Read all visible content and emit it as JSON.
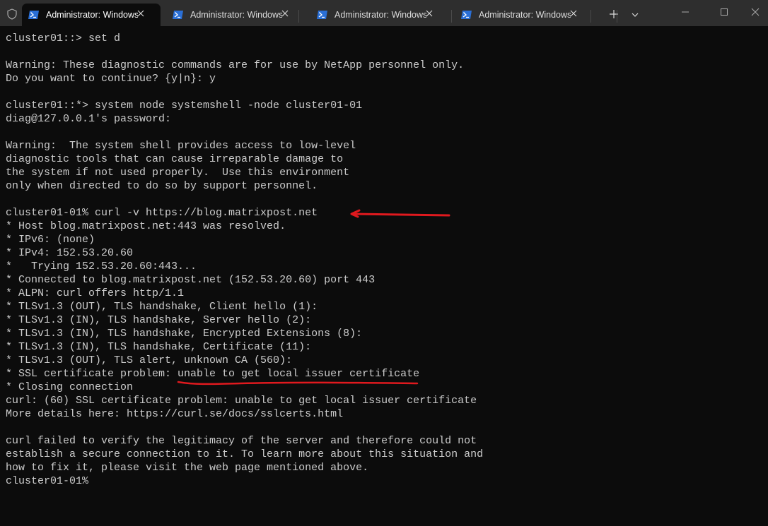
{
  "window": {
    "tabs": [
      {
        "label": "Administrator: Windows PowerShell",
        "active": true
      },
      {
        "label": "Administrator: Windows PowerShell",
        "active": false
      },
      {
        "label": "Administrator: Windows PowerShell",
        "active": false
      },
      {
        "label": "Administrator: Windows PowerShell",
        "active": false
      }
    ],
    "accent": "#2a6fd6"
  },
  "terminal": {
    "lines": [
      "cluster01::> set d",
      "",
      "Warning: These diagnostic commands are for use by NetApp personnel only.",
      "Do you want to continue? {y|n}: y",
      "",
      "cluster01::*> system node systemshell -node cluster01-01",
      "diag@127.0.0.1's password:",
      "",
      "Warning:  The system shell provides access to low-level",
      "diagnostic tools that can cause irreparable damage to",
      "the system if not used properly.  Use this environment",
      "only when directed to do so by support personnel.",
      "",
      "cluster01-01% curl -v https://blog.matrixpost.net",
      "* Host blog.matrixpost.net:443 was resolved.",
      "* IPv6: (none)",
      "* IPv4: 152.53.20.60",
      "*   Trying 152.53.20.60:443...",
      "* Connected to blog.matrixpost.net (152.53.20.60) port 443",
      "* ALPN: curl offers http/1.1",
      "* TLSv1.3 (OUT), TLS handshake, Client hello (1):",
      "* TLSv1.3 (IN), TLS handshake, Server hello (2):",
      "* TLSv1.3 (IN), TLS handshake, Encrypted Extensions (8):",
      "* TLSv1.3 (IN), TLS handshake, Certificate (11):",
      "* TLSv1.3 (OUT), TLS alert, unknown CA (560):",
      "* SSL certificate problem: unable to get local issuer certificate",
      "* Closing connection",
      "curl: (60) SSL certificate problem: unable to get local issuer certificate",
      "More details here: https://curl.se/docs/sslcerts.html",
      "",
      "curl failed to verify the legitimacy of the server and therefore could not",
      "establish a secure connection to it. To learn more about this situation and",
      "how to fix it, please visit the web page mentioned above.",
      "cluster01-01%"
    ],
    "text_color": "#cccccc",
    "background": "#0c0c0c",
    "annotation_color": "#e0191e"
  }
}
